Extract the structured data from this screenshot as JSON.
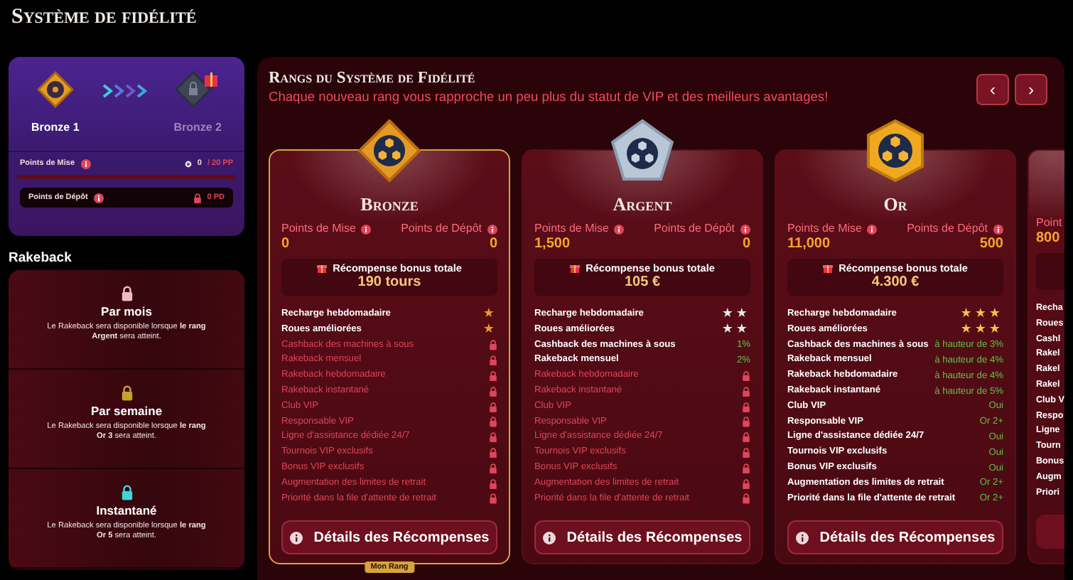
{
  "page_title": "Système de fidélité",
  "progress": {
    "current": "Bronze 1",
    "next": "Bronze 2",
    "stake_label": "Points de Mise",
    "stake_value": "0",
    "stake_target": "/ 20 PP",
    "level": 0,
    "deposit_label": "Points de Dépôt",
    "deposit_value": "0 PD"
  },
  "rakeback": {
    "title": "Rakeback",
    "items": [
      {
        "title": "Par mois",
        "color": "#f2b8c6",
        "text": "Le Rakeback sera disponible lorsque **le rang Argent** sera atteint."
      },
      {
        "title": "Par semaine",
        "color": "#c9a227",
        "text": "Le Rakeback sera disponible lorsque **le rang Or 3** sera atteint."
      },
      {
        "title": "Instantané",
        "color": "#3fd6d6",
        "text": "Le Rakeback sera disponible lorsque **le rang Or 5** sera atteint."
      }
    ]
  },
  "ranks": {
    "title": "Rangs du Système de Fidélité",
    "subtitle": "Chaque nouveau rang vous rapproche un peu plus du statut de VIP et des meilleurs avantages!",
    "nav": [
      "‹",
      "›"
    ],
    "cards": [
      {
        "kind": "diamond",
        "title": "Bronze",
        "current": true,
        "tag": "Mon Rang",
        "stake_label": "Points de Mise",
        "stake": "0",
        "deposit_label": "Points de Dépôt",
        "deposit": "0",
        "reward_label": "Récompense bonus totale",
        "reward": "190 tours",
        "button": "Détails des Récompenses",
        "benefits": [
          {
            "label": "Recharge hebdomadaire",
            "kind": "stars",
            "value": "★"
          },
          {
            "label": "Roues améliorées",
            "kind": "stars",
            "value": "★"
          },
          {
            "label": "Cashback des machines à sous",
            "kind": "locked"
          },
          {
            "label": "Rakeback mensuel",
            "kind": "locked"
          },
          {
            "label": "Rakeback hebdomadaire",
            "kind": "locked"
          },
          {
            "label": "Rakeback instantané",
            "kind": "locked"
          },
          {
            "label": "Club VIP",
            "kind": "locked"
          },
          {
            "label": "Responsable VIP",
            "kind": "locked"
          },
          {
            "label": "Ligne d'assistance dédiée 24/7",
            "kind": "locked"
          },
          {
            "label": "Tournois VIP exclusifs",
            "kind": "locked"
          },
          {
            "label": "Bonus VIP exclusifs",
            "kind": "locked"
          },
          {
            "label": "Augmentation des limites de retrait",
            "kind": "locked"
          },
          {
            "label": "Priorité dans la file d'attente de retrait",
            "kind": "locked"
          }
        ]
      },
      {
        "kind": "pentagon",
        "title": "Argent",
        "current": false,
        "stake_label": "Points de Mise",
        "stake": "1,500",
        "deposit_label": "Points de Dépôt",
        "deposit": "0",
        "reward_label": "Récompense bonus totale",
        "reward": "105 €",
        "button": "Détails des Récompenses",
        "benefits": [
          {
            "label": "Recharge hebdomadaire",
            "kind": "stars",
            "value": "★★"
          },
          {
            "label": "Roues améliorées",
            "kind": "stars",
            "value": "★★"
          },
          {
            "label": "Cashback des machines à sous",
            "kind": "value",
            "value": "1%"
          },
          {
            "label": "Rakeback mensuel",
            "kind": "value",
            "value": "2%"
          },
          {
            "label": "Rakeback hebdomadaire",
            "kind": "locked"
          },
          {
            "label": "Rakeback instantané",
            "kind": "locked"
          },
          {
            "label": "Club VIP",
            "kind": "locked"
          },
          {
            "label": "Responsable VIP",
            "kind": "locked"
          },
          {
            "label": "Ligne d'assistance dédiée 24/7",
            "kind": "locked"
          },
          {
            "label": "Tournois VIP exclusifs",
            "kind": "locked"
          },
          {
            "label": "Bonus VIP exclusifs",
            "kind": "locked"
          },
          {
            "label": "Augmentation des limites de retrait",
            "kind": "locked"
          },
          {
            "label": "Priorité dans la file d'attente de retrait",
            "kind": "locked"
          }
        ]
      },
      {
        "kind": "hexagon",
        "title": "Or",
        "current": false,
        "stake_label": "Points de Mise",
        "stake": "11,000",
        "deposit_label": "Points de Dépôt",
        "deposit": "500",
        "reward_label": "Récompense bonus totale",
        "reward": "4.300 €",
        "button": "Détails des Récompenses",
        "benefits": [
          {
            "label": "Recharge hebdomadaire",
            "kind": "stars",
            "value": "★★★"
          },
          {
            "label": "Roues améliorées",
            "kind": "stars",
            "value": "★★★"
          },
          {
            "label": "Cashback des machines à sous",
            "kind": "value",
            "value": "à hauteur de 3%"
          },
          {
            "label": "Rakeback mensuel",
            "kind": "value",
            "value": "à hauteur de 4%"
          },
          {
            "label": "Rakeback hebdomadaire",
            "kind": "value",
            "value": "à hauteur de 4%"
          },
          {
            "label": "Rakeback instantané",
            "kind": "value",
            "value": "à hauteur de 5%"
          },
          {
            "label": "Club VIP",
            "kind": "value",
            "value": "Oui"
          },
          {
            "label": "Responsable VIP",
            "kind": "value",
            "value": "Or 2+"
          },
          {
            "label": "Ligne d'assistance dédiée 24/7",
            "kind": "value",
            "value": "Oui"
          },
          {
            "label": "Tournois VIP exclusifs",
            "kind": "value",
            "value": "Oui"
          },
          {
            "label": "Bonus VIP exclusifs",
            "kind": "value",
            "value": "Oui"
          },
          {
            "label": "Augmentation des limites de retrait",
            "kind": "value",
            "value": "Or 2+"
          },
          {
            "label": "Priorité dans la file d'attente de retrait",
            "kind": "value",
            "value": "Or 2+"
          }
        ]
      },
      {
        "kind": "partial",
        "stake_label": "Point",
        "stake": "800",
        "benefits": [
          {
            "label": "Recha"
          },
          {
            "label": "Roues"
          },
          {
            "label": "Cashl"
          },
          {
            "label": "Rakel"
          },
          {
            "label": "Rakel"
          },
          {
            "label": "Rakel"
          },
          {
            "label": "Club V"
          },
          {
            "label": "Respo"
          },
          {
            "label": "Ligne"
          },
          {
            "label": "Tourn"
          },
          {
            "label": "Bonus"
          },
          {
            "label": "Augm"
          },
          {
            "label": "Priori"
          }
        ]
      }
    ]
  }
}
